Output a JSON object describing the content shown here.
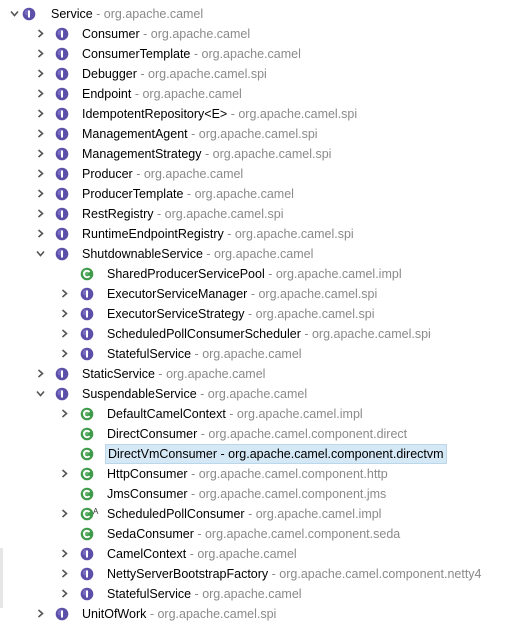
{
  "tree": {
    "items": [
      {
        "name": "Service",
        "pkg": "org.apache.camel",
        "kind": "root-interface",
        "level": 0,
        "twisty": "expanded"
      },
      {
        "name": "Consumer",
        "pkg": "org.apache.camel",
        "kind": "interface",
        "level": 1,
        "twisty": "collapsed"
      },
      {
        "name": "ConsumerTemplate",
        "pkg": "org.apache.camel",
        "kind": "interface",
        "level": 1,
        "twisty": "collapsed"
      },
      {
        "name": "Debugger",
        "pkg": "org.apache.camel.spi",
        "kind": "interface",
        "level": 1,
        "twisty": "collapsed"
      },
      {
        "name": "Endpoint",
        "pkg": "org.apache.camel",
        "kind": "interface",
        "level": 1,
        "twisty": "collapsed"
      },
      {
        "name": "IdempotentRepository<E>",
        "pkg": "org.apache.camel.spi",
        "kind": "interface",
        "level": 1,
        "twisty": "collapsed"
      },
      {
        "name": "ManagementAgent",
        "pkg": "org.apache.camel.spi",
        "kind": "interface",
        "level": 1,
        "twisty": "collapsed"
      },
      {
        "name": "ManagementStrategy",
        "pkg": "org.apache.camel.spi",
        "kind": "interface",
        "level": 1,
        "twisty": "collapsed"
      },
      {
        "name": "Producer",
        "pkg": "org.apache.camel",
        "kind": "interface",
        "level": 1,
        "twisty": "collapsed"
      },
      {
        "name": "ProducerTemplate",
        "pkg": "org.apache.camel",
        "kind": "interface",
        "level": 1,
        "twisty": "collapsed"
      },
      {
        "name": "RestRegistry",
        "pkg": "org.apache.camel.spi",
        "kind": "interface",
        "level": 1,
        "twisty": "collapsed"
      },
      {
        "name": "RuntimeEndpointRegistry",
        "pkg": "org.apache.camel.spi",
        "kind": "interface",
        "level": 1,
        "twisty": "collapsed"
      },
      {
        "name": "ShutdownableService",
        "pkg": "org.apache.camel",
        "kind": "interface",
        "level": 1,
        "twisty": "expanded"
      },
      {
        "name": "SharedProducerServicePool",
        "pkg": "org.apache.camel.impl",
        "kind": "class",
        "level": 2,
        "twisty": "none"
      },
      {
        "name": "ExecutorServiceManager",
        "pkg": "org.apache.camel.spi",
        "kind": "interface",
        "level": 2,
        "twisty": "collapsed"
      },
      {
        "name": "ExecutorServiceStrategy",
        "pkg": "org.apache.camel.spi",
        "kind": "interface",
        "level": 2,
        "twisty": "collapsed"
      },
      {
        "name": "ScheduledPollConsumerScheduler",
        "pkg": "org.apache.camel.spi",
        "kind": "interface",
        "level": 2,
        "twisty": "collapsed"
      },
      {
        "name": "StatefulService",
        "pkg": "org.apache.camel",
        "kind": "interface",
        "level": 2,
        "twisty": "collapsed"
      },
      {
        "name": "StaticService",
        "pkg": "org.apache.camel",
        "kind": "interface",
        "level": 1,
        "twisty": "collapsed"
      },
      {
        "name": "SuspendableService",
        "pkg": "org.apache.camel",
        "kind": "interface",
        "level": 1,
        "twisty": "expanded"
      },
      {
        "name": "DefaultCamelContext",
        "pkg": "org.apache.camel.impl",
        "kind": "class",
        "level": 2,
        "twisty": "collapsed"
      },
      {
        "name": "DirectConsumer",
        "pkg": "org.apache.camel.component.direct",
        "kind": "class",
        "level": 2,
        "twisty": "none"
      },
      {
        "name": "DirectVmConsumer",
        "pkg": "org.apache.camel.component.directvm",
        "kind": "class",
        "level": 2,
        "twisty": "none",
        "selected": true
      },
      {
        "name": "HttpConsumer",
        "pkg": "org.apache.camel.component.http",
        "kind": "class",
        "level": 2,
        "twisty": "collapsed"
      },
      {
        "name": "JmsConsumer",
        "pkg": "org.apache.camel.component.jms",
        "kind": "class",
        "level": 2,
        "twisty": "none"
      },
      {
        "name": "ScheduledPollConsumer",
        "pkg": "org.apache.camel.impl",
        "kind": "abstract-class",
        "level": 2,
        "twisty": "collapsed"
      },
      {
        "name": "SedaConsumer",
        "pkg": "org.apache.camel.component.seda",
        "kind": "class",
        "level": 2,
        "twisty": "none"
      },
      {
        "name": "CamelContext",
        "pkg": "org.apache.camel",
        "kind": "interface",
        "level": 2,
        "twisty": "collapsed"
      },
      {
        "name": "NettyServerBootstrapFactory",
        "pkg": "org.apache.camel.component.netty4",
        "kind": "interface",
        "level": 2,
        "twisty": "collapsed"
      },
      {
        "name": "StatefulService",
        "pkg": "org.apache.camel",
        "kind": "interface",
        "level": 2,
        "twisty": "collapsed"
      },
      {
        "name": "UnitOfWork",
        "pkg": "org.apache.camel.spi",
        "kind": "interface",
        "level": 1,
        "twisty": "collapsed"
      }
    ],
    "separator": " - ",
    "abstract_marker": "A"
  },
  "colors": {
    "interface_icon": "#5b4fa8",
    "class_icon": "#3f9a4a",
    "selection_bg": "#d5e8f5",
    "package_text": "#8a8a8a"
  }
}
